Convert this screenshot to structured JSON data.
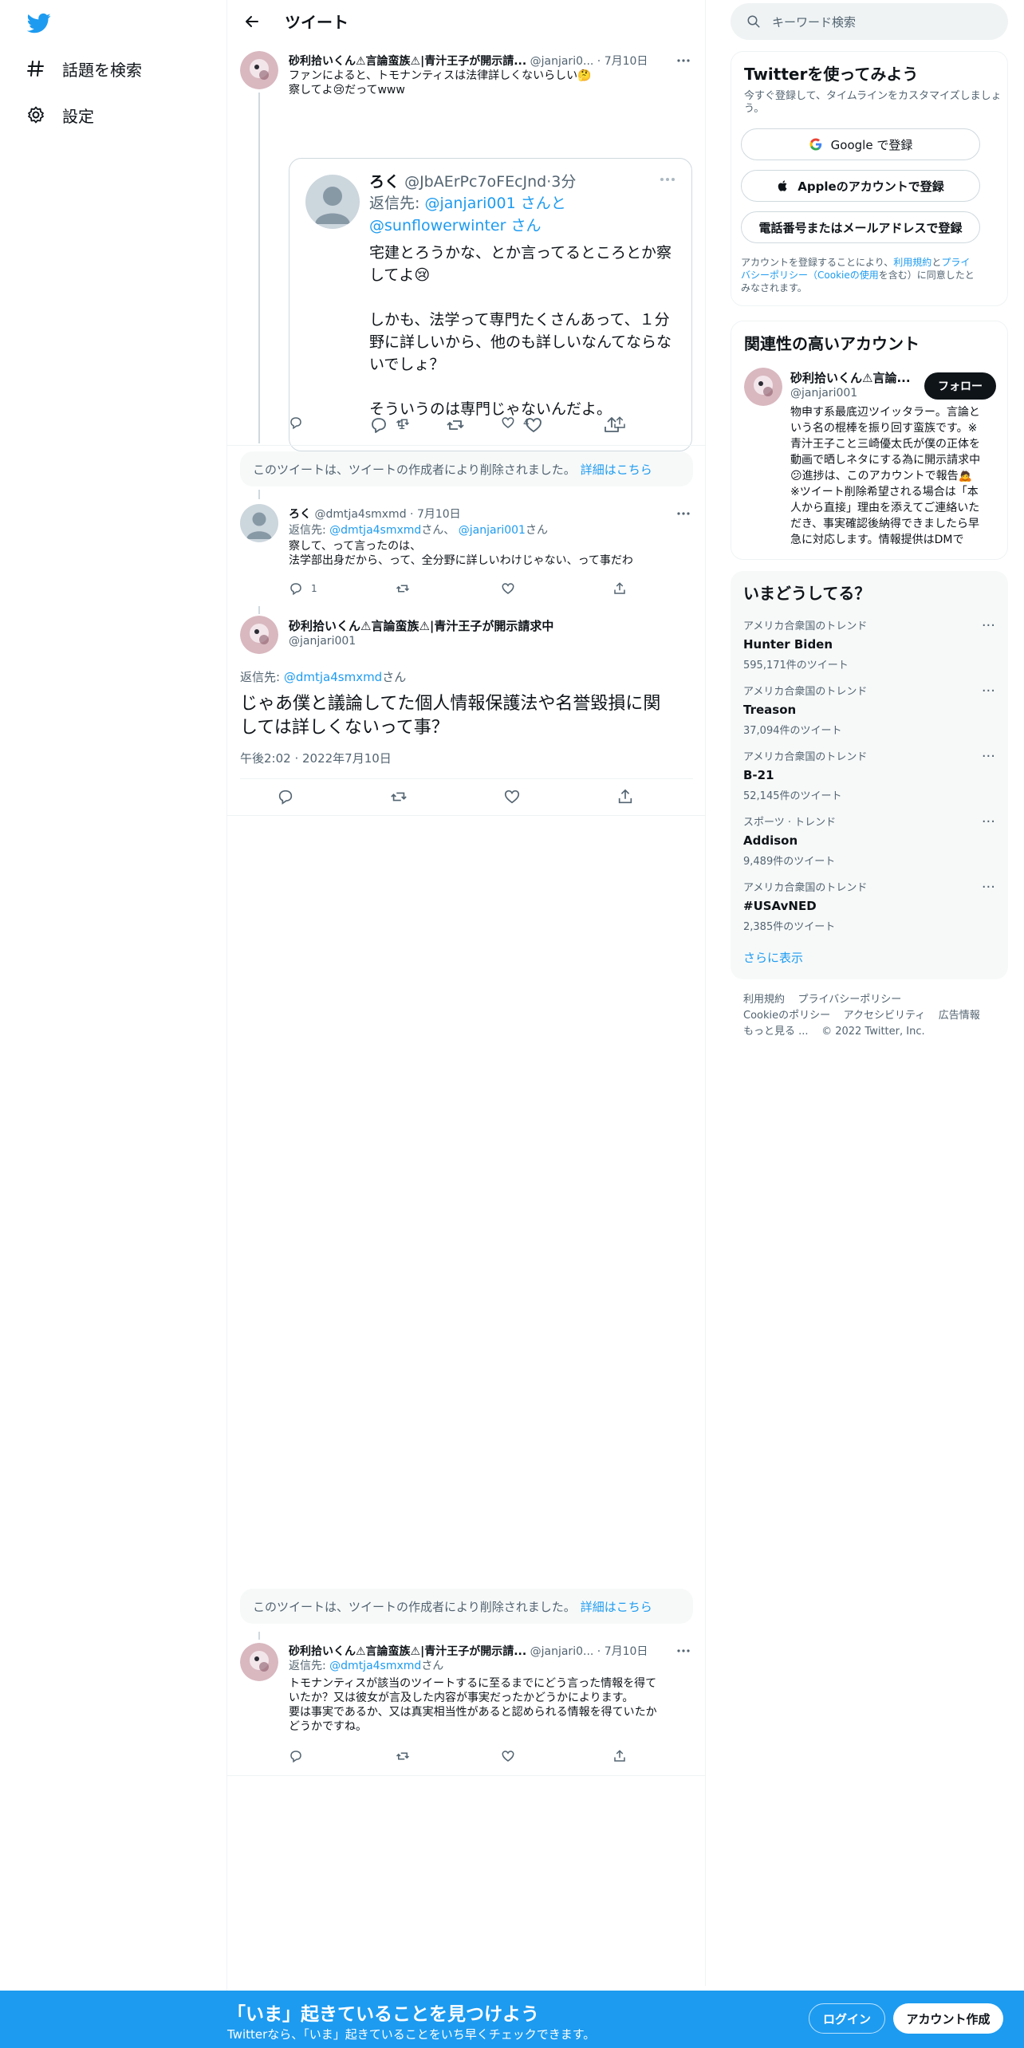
{
  "nav": {
    "items": [
      {
        "label": "話題を検索",
        "icon": "hashtag-icon"
      },
      {
        "label": "設定",
        "icon": "gear-icon"
      }
    ]
  },
  "header": {
    "title": "ツイート"
  },
  "tweets": {
    "t1": {
      "name": "砂利拾いくん⚠言論蛮族⚠|青汁王子が開示請...",
      "handle": "@janjari0...",
      "date": "7月10日",
      "line1": "ファンによると、トモナンティスは法律詳しくないらしい🤔",
      "line2": "察してよ😢だってwww",
      "likes": "4"
    },
    "quote": {
      "name": "ろく",
      "handle": "@JbAErPc7oFEcJnd",
      "time": "3分",
      "reply_label": "返信先:",
      "reply_to1": "@janjari001 さんと",
      "reply_to2": "@sunflowerwinter さん",
      "p1a": "宅建とろうかな、とか言ってるところとか察",
      "p1b": "してよ😢",
      "p2a": "しかも、法学って専門たくさんあって、１分",
      "p2b": "野に詳しいから、他のも詳しいなんてならな",
      "p2c": "いでしょ？",
      "p3": "そういうのは専門じゃないんだよ。",
      "replies": "1"
    },
    "deleted": {
      "text": "このツイートは、ツイートの作成者により削除されました。",
      "link": "詳細はこちら"
    },
    "t2": {
      "name": "ろく",
      "handle": "@dmtja4smxmd",
      "date": "7月10日",
      "reply_label": "返信先:",
      "reply_to1": "@dmtja4smxmd",
      "reply_san1": "さん、",
      "reply_to2": "@janjari001",
      "reply_san2": "さん",
      "line1": "察して、って言ったのは、",
      "line2": "法学部出身だから、って、全分野に詳しいわけじゃない、って事だわ",
      "replies": "1"
    },
    "main": {
      "name": "砂利拾いくん⚠言論蛮族⚠|青汁王子が開示請求中",
      "handle": "@janjari001",
      "reply_label": "返信先:",
      "reply_to": "@dmtja4smxmd",
      "reply_san": "さん",
      "text1": "じゃあ僕と議論してた個人情報保護法や名誉毀損に関",
      "text2": "しては詳しくないって事？",
      "timestamp": "午後2:02 · 2022年7月10日"
    },
    "t4": {
      "name": "砂利拾いくん⚠言論蛮族⚠|青汁王子が開示請...",
      "handle": "@janjari0...",
      "date": "7月10日",
      "reply_label": "返信先:",
      "reply_to": "@dmtja4smxmd",
      "reply_san": "さん",
      "line1": "トモナンティスが該当のツイートするに至るまでにどう言った情報を得て",
      "line2": "いたか？又は彼女が言及した内容が事実だったかどうかによります。",
      "line3": "要は事実であるか、又は真実相当性があると認められる情報を得ていたか",
      "line4": "どうかですね。"
    }
  },
  "sidebar": {
    "search_placeholder": "キーワード検索",
    "signup": {
      "title": "Twitterを使ってみよう",
      "desc1": "今すぐ登録して、タイムラインをカスタマイズしましょ",
      "desc2": "う。",
      "google": "Google で登録",
      "apple": "Appleのアカウントで登録",
      "phone": "電話番号またはメールアドレスで登録",
      "legal1a": "アカウントを登録することにより、",
      "legal1b": "利用規約",
      "legal1c": "と",
      "legal1d": "プライ",
      "legal2a": "バシーポリシー（Cookieの使用",
      "legal2b": "を含む）に同意したと",
      "legal3": "みなされます。"
    },
    "related": {
      "title": "関連性の高いアカウント",
      "name": "砂利拾いくん⚠言論...",
      "handle": "@janjari001",
      "follow": "フォロー",
      "bio": [
        "物申す系最底辺ツイッタラー。言論と",
        "いう名の棍棒を振り回す蛮族です。※",
        "青汁王子こと三崎優太氏が僕の正体を",
        "動画で晒しネタにする為に開示請求中",
        "😕進捗は、このアカウントで報告🙇",
        "※ツイート削除希望される場合は「本",
        "人から直接」理由を添えてご連絡いた",
        "だき、事実確認後納得できましたら早",
        "急に対応します。情報提供はDMで"
      ]
    },
    "trends": {
      "title": "いまどうしてる？",
      "items": [
        {
          "category": "アメリカ合衆国のトレンド",
          "name": "Hunter Biden",
          "count": "595,171件のツイート"
        },
        {
          "category": "アメリカ合衆国のトレンド",
          "name": "Treason",
          "count": "37,094件のツイート"
        },
        {
          "category": "アメリカ合衆国のトレンド",
          "name": "B-21",
          "count": "52,145件のツイート"
        },
        {
          "category": "スポーツ · トレンド",
          "name": "Addison",
          "count": "9,489件のツイート"
        },
        {
          "category": "アメリカ合衆国のトレンド",
          "name": "#USAvNED",
          "count": "2,385件のツイート"
        }
      ],
      "more": "さらに表示"
    },
    "footer": {
      "terms": "利用規約",
      "privacy": "プライバシーポリシー",
      "cookie": "Cookieのポリシー",
      "access": "アクセシビリティ",
      "ads": "広告情報",
      "more": "もっと見る ...",
      "copyright": "© 2022 Twitter, Inc."
    }
  },
  "bottombar": {
    "title": "「いま」起きていることを見つけよう",
    "subtitle": "Twitterなら、「いま」起きていることをいち早くチェックできます。",
    "login": "ログイン",
    "signup": "アカウント作成"
  },
  "colors": {
    "accent": "#1d9bf0",
    "text": "#0f1419",
    "secondary": "#536471"
  }
}
